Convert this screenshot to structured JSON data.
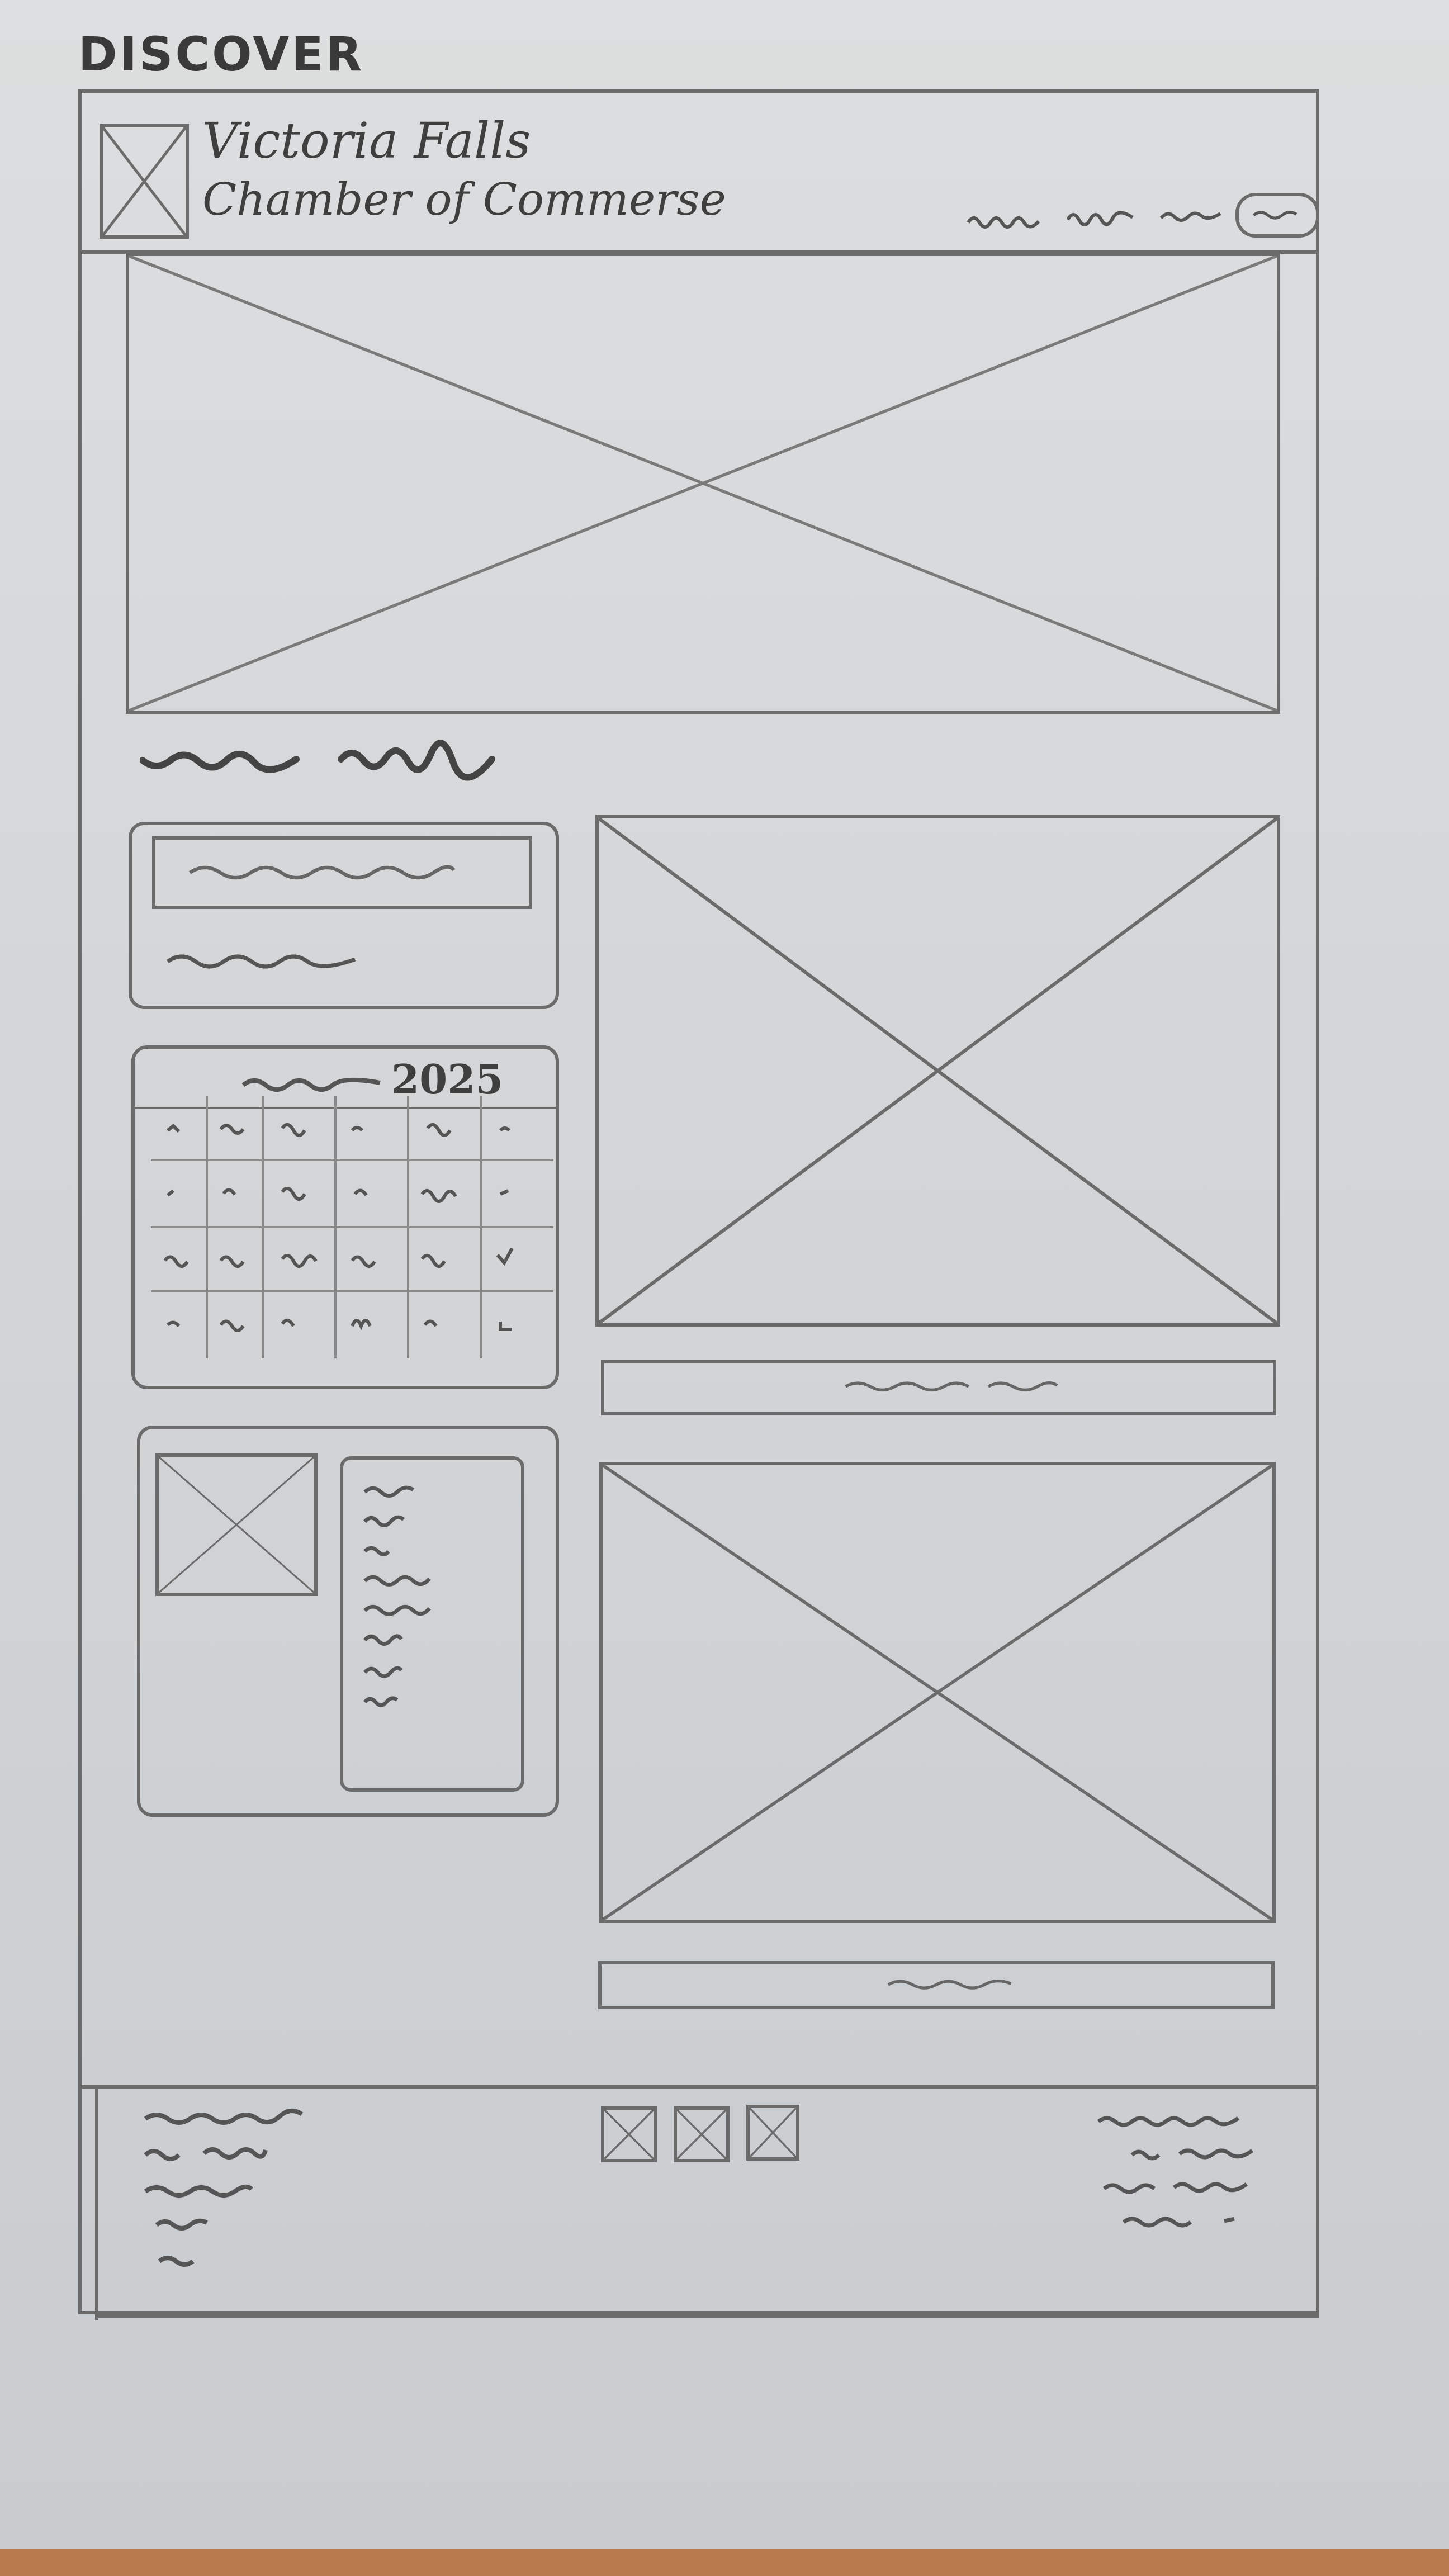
{
  "page_label": "DISCOVER",
  "header": {
    "org_name_line1": "Victoria Falls",
    "org_name_line2": "Chamber of Commerse"
  },
  "calendar": {
    "year": "2025"
  },
  "icons": {
    "logo": "image-placeholder-icon",
    "social": [
      "image-placeholder-icon",
      "image-placeholder-icon",
      "image-placeholder-icon"
    ]
  }
}
